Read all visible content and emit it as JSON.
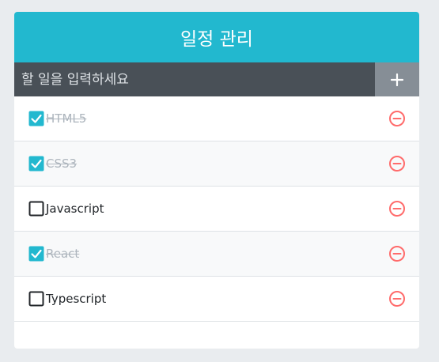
{
  "header": {
    "title": "일정 관리"
  },
  "insert": {
    "placeholder": "할 일을 입력하세요",
    "value": ""
  },
  "todos": [
    {
      "text": "HTML5",
      "checked": true
    },
    {
      "text": "CSS3",
      "checked": true
    },
    {
      "text": "Javascript",
      "checked": false
    },
    {
      "text": "React",
      "checked": true
    },
    {
      "text": "Typescript",
      "checked": false
    }
  ],
  "colors": {
    "header_bg": "#22b8cf",
    "form_bg": "#495057",
    "add_button_bg": "#868e96",
    "checkbox_checked": "#22b8cf",
    "remove_icon": "#ff6b6b",
    "checked_text": "#adb5bd"
  }
}
